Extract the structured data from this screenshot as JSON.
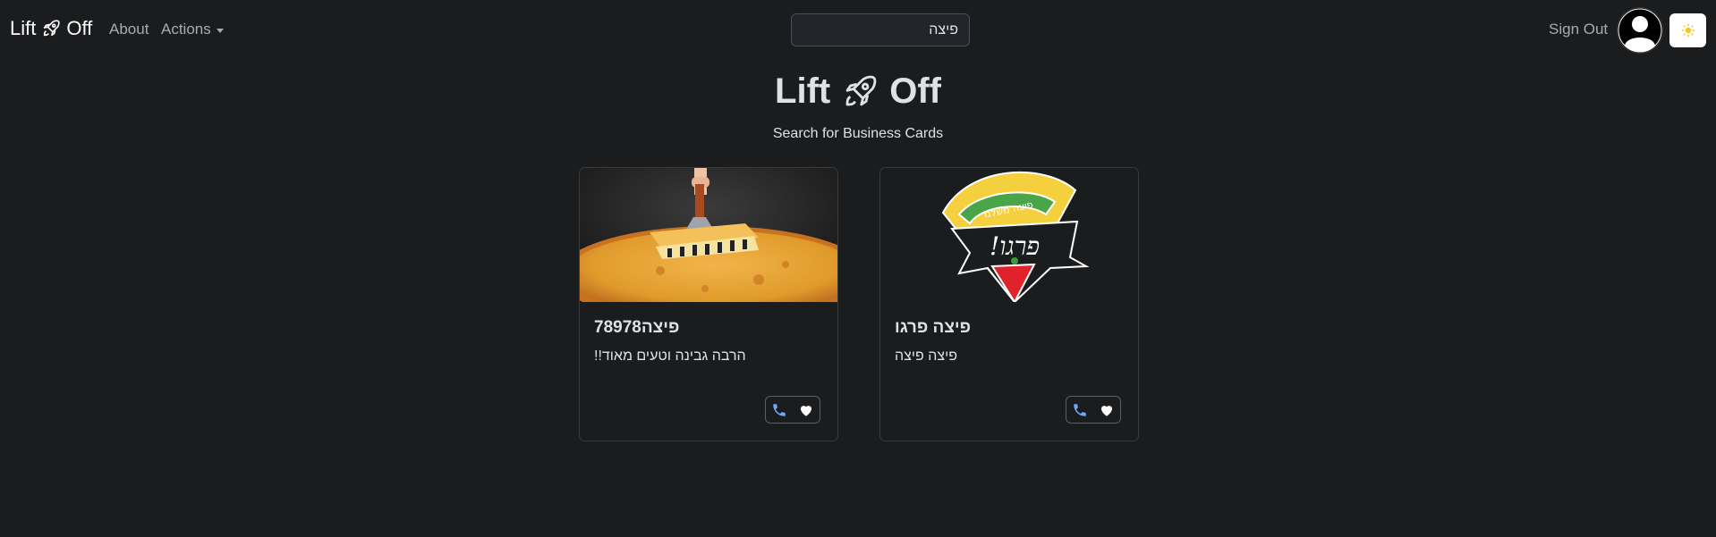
{
  "nav": {
    "brand_left": "Lift",
    "brand_right": "Off",
    "about": "About",
    "actions": "Actions",
    "search_value": "פיצה",
    "sign_out": "Sign Out"
  },
  "header": {
    "title_left": "Lift",
    "title_right": "Off",
    "subtitle": "Search for Business Cards"
  },
  "cards": [
    {
      "title": "פיצה78978",
      "text": "הרבה גבינה וטעים מאוד!!"
    },
    {
      "title": "פיצה פרגו",
      "text": "פיצה פיצה",
      "logo_banner": "פיצה משלנו",
      "logo_word": "פרגו!"
    }
  ],
  "colors": {
    "background": "#1b1c1e",
    "phone_icon": "#6ea8fe",
    "heart_icon": "#ffffff"
  }
}
